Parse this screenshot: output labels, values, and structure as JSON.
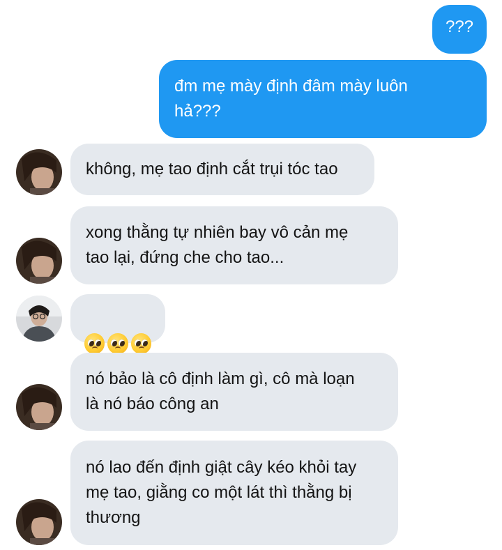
{
  "messages": [
    {
      "id": "m1",
      "direction": "outgoing",
      "text": "???"
    },
    {
      "id": "m2",
      "direction": "outgoing",
      "text": "đm mẹ mày định đâm mày luôn\nhả???"
    },
    {
      "id": "m3",
      "direction": "incoming",
      "text": "không, mẹ tao định cắt trụi tóc tao"
    },
    {
      "id": "m4",
      "direction": "incoming",
      "text": "xong thằng tự nhiên bay vô cản mẹ\ntao lại, đứng che cho tao..."
    },
    {
      "id": "m5",
      "direction": "incoming",
      "text": "🥺🥺🥺",
      "emoji_name": "pleading-face-emoji",
      "emoji_count": 3
    },
    {
      "id": "m6",
      "direction": "incoming",
      "text": "nó bảo là cô định làm gì, cô mà loạn\nlà nó báo công an"
    },
    {
      "id": "m7",
      "direction": "incoming",
      "text": "nó lao đến định giật cây kéo khỏi tay\nmẹ tao, giằng co một lát thì thằng bị\nthương"
    }
  ],
  "colors": {
    "outgoing_bubble": "#1f98f2",
    "incoming_bubble": "#e5e9ee",
    "incoming_text": "#141414",
    "outgoing_text": "#ffffff"
  }
}
